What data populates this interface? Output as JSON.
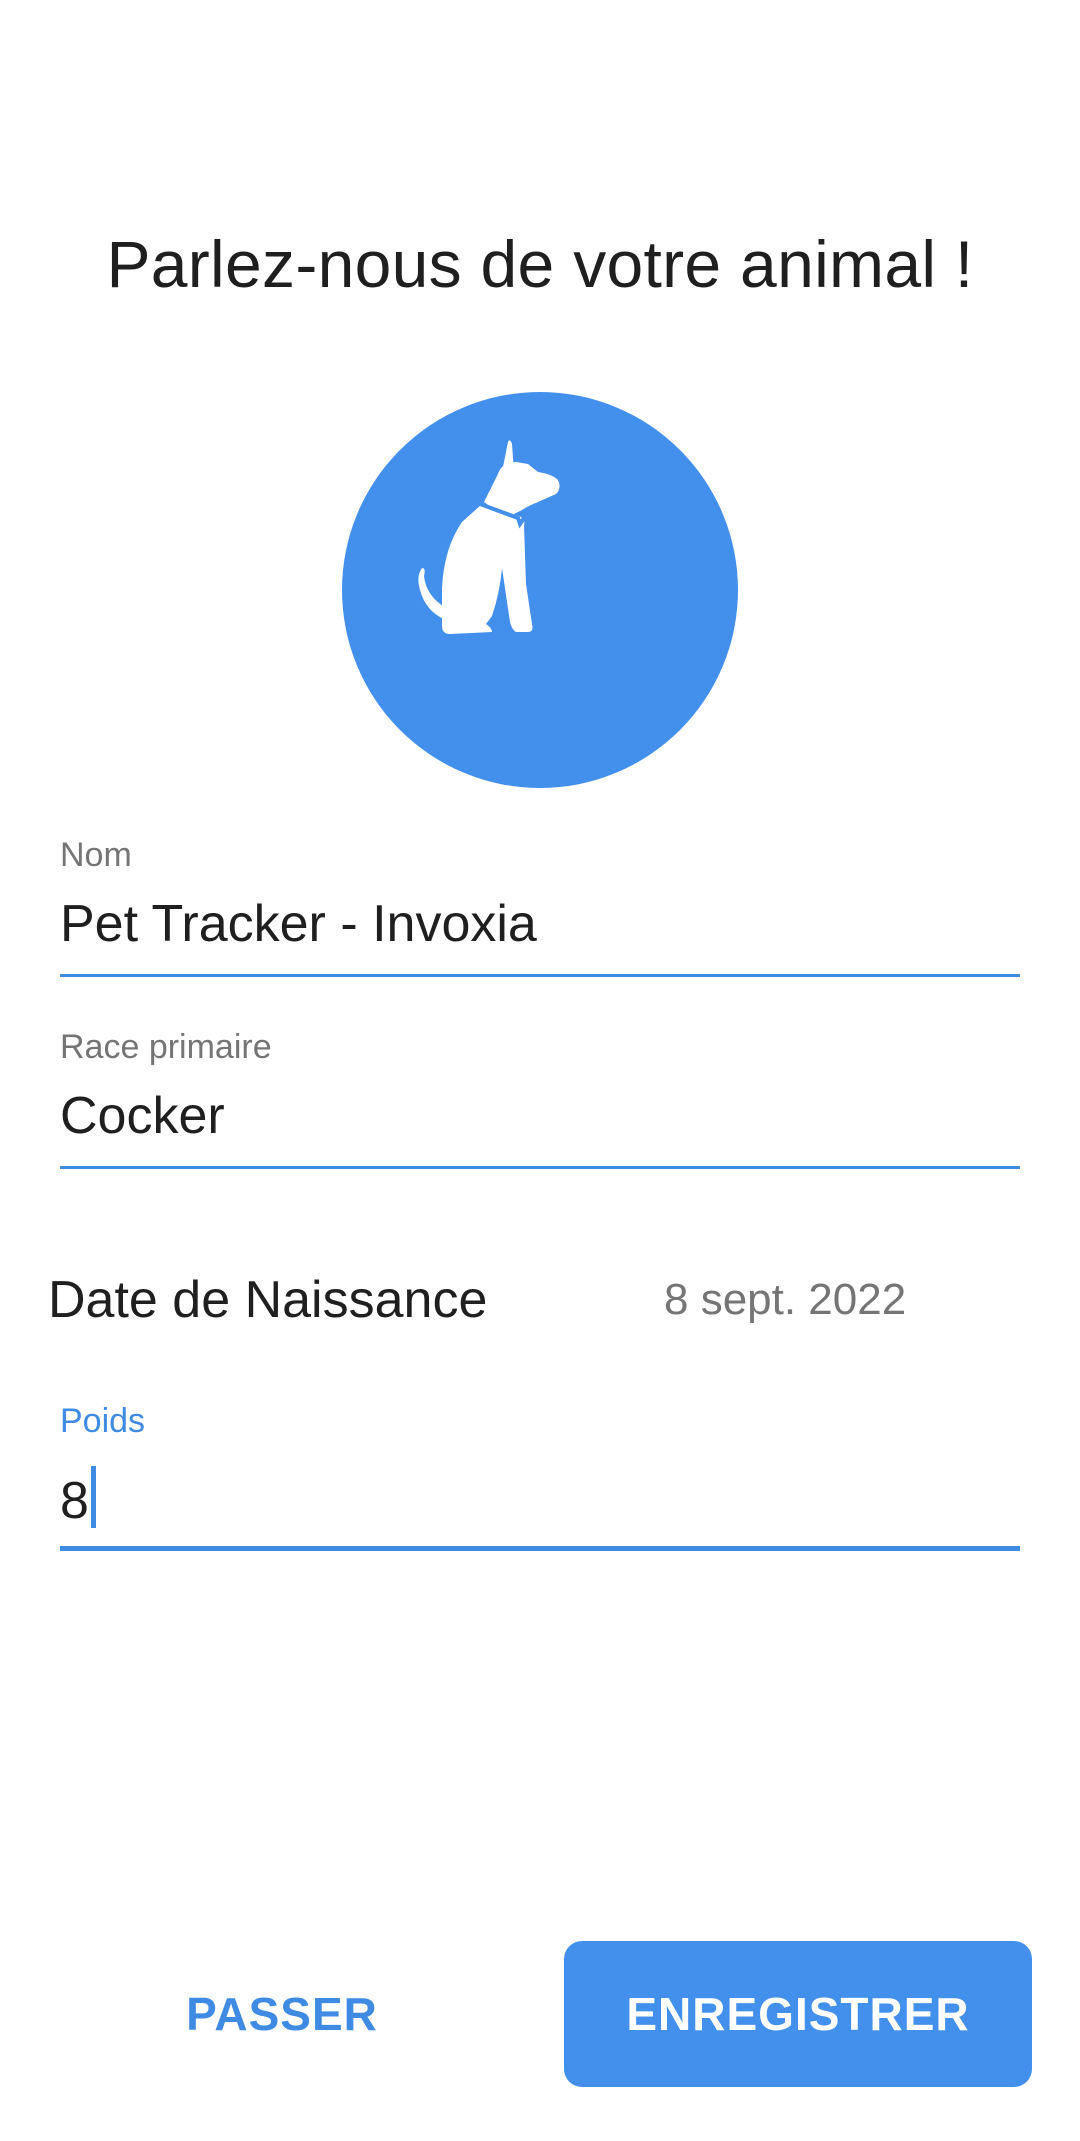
{
  "header": {
    "title": "Parlez-nous de votre animal !"
  },
  "avatar": {
    "icon": "sitting-dog-icon",
    "background_color": "#4290eb"
  },
  "form": {
    "name": {
      "label": "Nom",
      "value": "Pet Tracker - Invoxia"
    },
    "breed": {
      "label": "Race primaire",
      "value": "Cocker"
    },
    "birth_date": {
      "label": "Date de Naissance",
      "value": "8 sept. 2022"
    },
    "weight": {
      "label": "Poids",
      "value": "8"
    }
  },
  "actions": {
    "skip_label": "PASSER",
    "save_label": "ENREGISTRER"
  },
  "colors": {
    "accent": "#3f8be3",
    "primary_button": "#4290eb",
    "text_primary": "#1f1f1f",
    "text_secondary": "#757575"
  }
}
